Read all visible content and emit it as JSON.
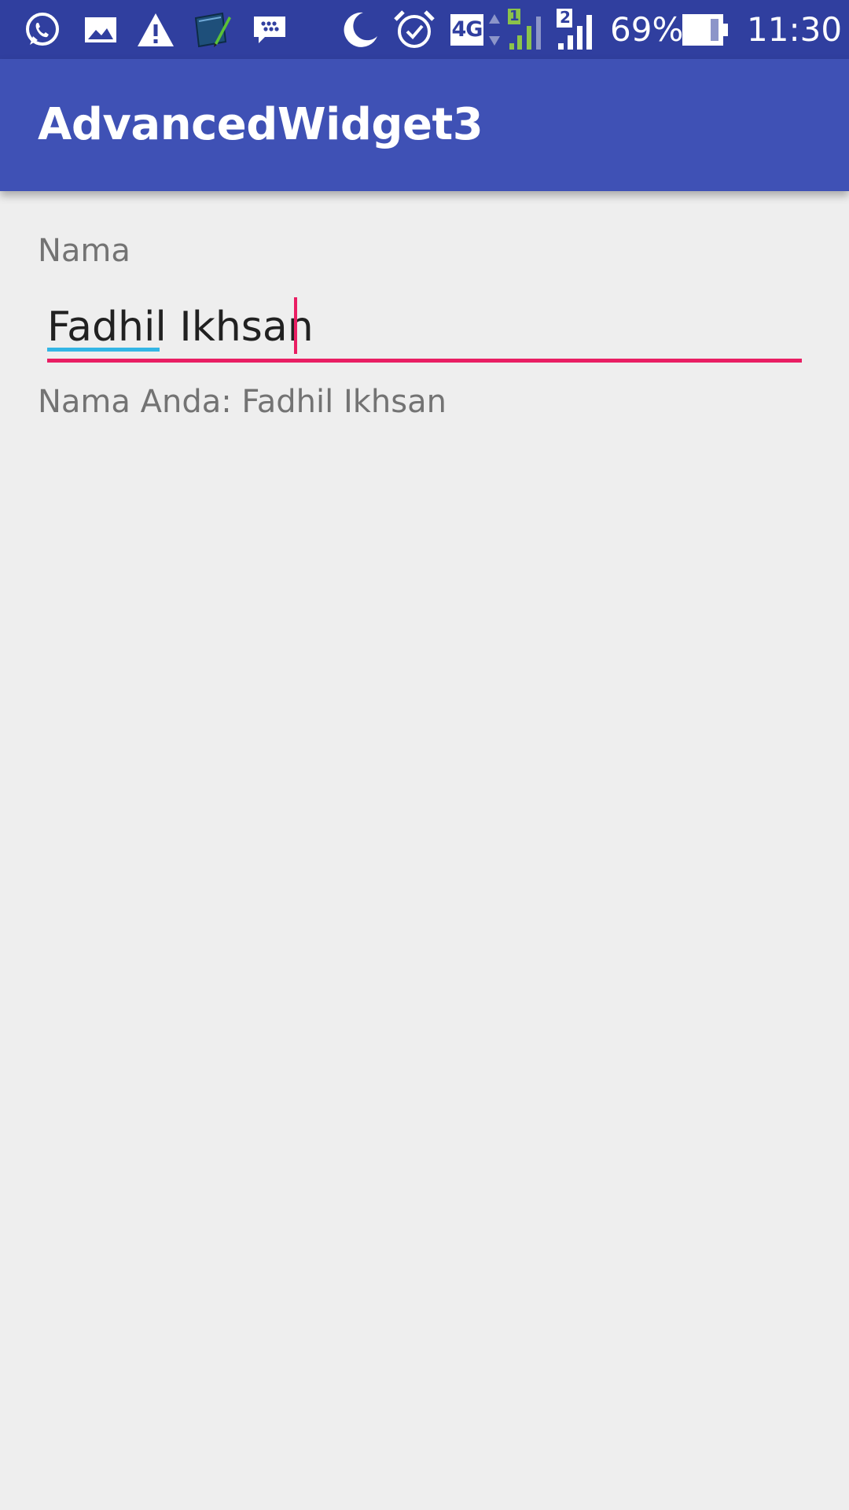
{
  "status_bar": {
    "battery_percent": "69%",
    "time": "11:30",
    "network_type": "4G",
    "sim1_label": "1",
    "sim2_label": "2",
    "background_color": "#303f9f",
    "icons_left": [
      "whatsapp-icon",
      "image-icon",
      "warning-icon",
      "notebook-app-icon",
      "bbm-icon"
    ],
    "icons_right": [
      "night-mode-icon",
      "alarm-icon",
      "4g-icon",
      "signal-sim1-icon",
      "signal-sim2-icon",
      "battery-icon"
    ]
  },
  "app_bar": {
    "title": "AdvancedWidget3",
    "background_color": "#3f51b5"
  },
  "form": {
    "name_label": "Nama",
    "name_value": "Fadhil Ikhsan",
    "accent_color": "#e91e63",
    "result_text": "Nama Anda: Fadhil Ikhsan"
  }
}
